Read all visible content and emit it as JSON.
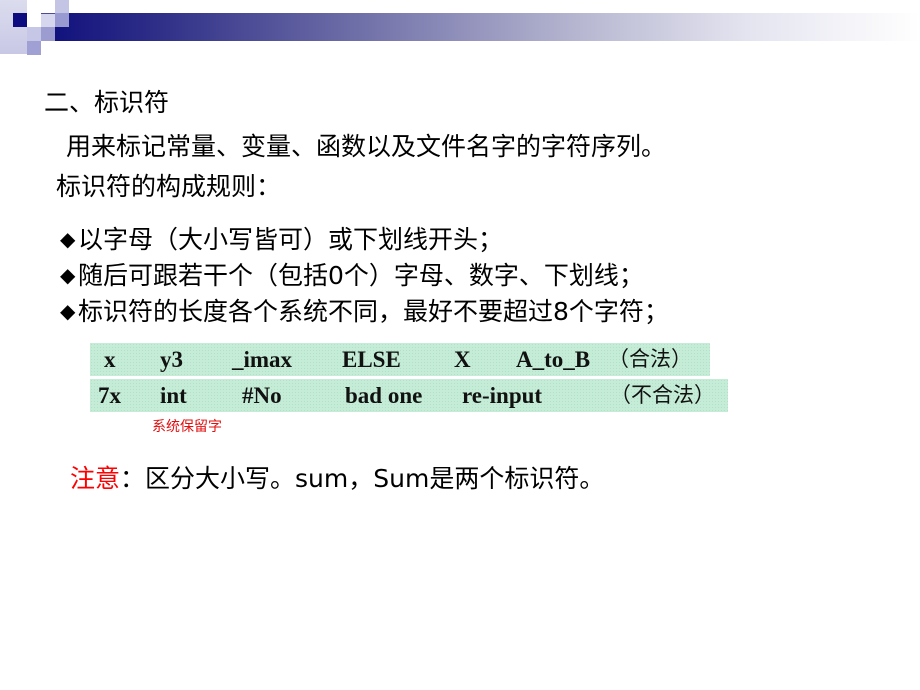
{
  "heading": "二、标识符",
  "description": "用来标记常量、变量、函数以及文件名字的字符序列。",
  "rules_title": "标识符的构成规则：",
  "bullet_icon": "black-diamond-icon",
  "bullet_glyph": "◆",
  "rules": [
    "以字母（大小写皆可）或下划线开头；",
    "随后可跟若干个（包括0个）字母、数字、下划线；",
    "标识符的长度各个系统不同，最好不要超过8个字符；"
  ],
  "examples": {
    "valid": {
      "items": [
        "x",
        "y3",
        "_imax",
        "ELSE",
        "X",
        "A_to_B"
      ],
      "label": "（合法）"
    },
    "invalid": {
      "items": [
        "7x",
        "int",
        "#No",
        "bad one",
        "re-input"
      ],
      "label": "（不合法）"
    },
    "highlight_color": "#c5ecd6"
  },
  "reserved_note": "系统保留字",
  "notice": {
    "label": "注意",
    "colon": "：",
    "text": "区分大小写。sum，Sum是两个标识符。",
    "label_color": "#ff0000"
  }
}
